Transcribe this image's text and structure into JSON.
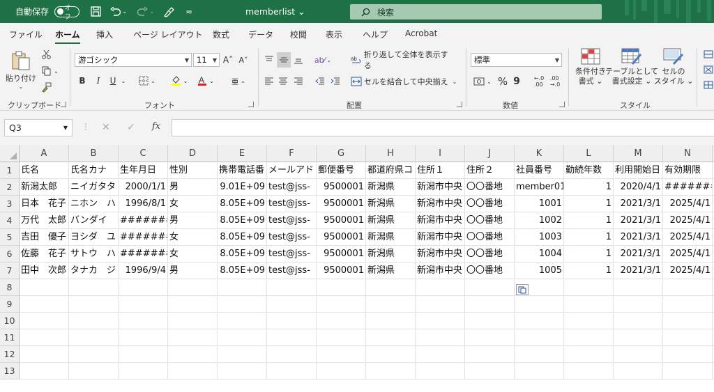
{
  "titlebar": {
    "autosave_label": "自動保存",
    "autosave_state": "オフ",
    "doc_title": "memberlist ⌄",
    "search_placeholder": "検索"
  },
  "menu": {
    "tabs": [
      "ファイル",
      "ホーム",
      "挿入",
      "ページ レイアウト",
      "数式",
      "データ",
      "校閲",
      "表示",
      "ヘルプ",
      "Acrobat"
    ],
    "active": "ホーム"
  },
  "ribbon": {
    "clipboard": {
      "paste_label": "貼り付け",
      "group_label": "クリップボード"
    },
    "font": {
      "font_name": "游ゴシック",
      "font_size": "11",
      "group_label": "フォント",
      "bold": "B",
      "italic": "I",
      "underline": "U"
    },
    "alignment": {
      "wrap_text": "折り返して全体を表示する",
      "merge_center": "セルを結合して中央揃え",
      "group_label": "配置"
    },
    "number": {
      "format": "標準",
      "percent": "%",
      "comma": "9",
      "group_label": "数値"
    },
    "styles": {
      "conditional": "条件付き\n書式 ⌄",
      "table": "テーブルとして\n書式設定 ⌄",
      "cell": "セルの\nスタイル ⌄",
      "group_label": "スタイル"
    }
  },
  "formula_bar": {
    "name_box": "Q3",
    "fx": "fx",
    "formula": ""
  },
  "grid": {
    "columns": [
      "A",
      "B",
      "C",
      "D",
      "E",
      "F",
      "G",
      "H",
      "I",
      "J",
      "K",
      "L",
      "M",
      "N"
    ],
    "rows": [
      "1",
      "2",
      "3",
      "4",
      "5",
      "6",
      "7",
      "8",
      "9",
      "10",
      "11",
      "12",
      "13"
    ],
    "data": [
      [
        "氏名",
        "氏名カナ",
        "生年月日",
        "性別",
        "携帯電話番",
        "メールアド",
        "郵便番号",
        "都道府県コ",
        "住所１",
        "住所２",
        "社員番号",
        "勤続年数",
        "利用開始日",
        "有効期限"
      ],
      [
        "新潟太郎",
        "ニイガタタ",
        "2000/1/1",
        "男",
        "9.01E+09",
        "test@jss-",
        "9500001",
        "新潟県",
        "新潟市中央",
        "〇〇番地",
        "member01",
        "1",
        "2020/4/1",
        "#######"
      ],
      [
        "日本　花子",
        "ニホン　ハ",
        "1996/8/1",
        "女",
        "8.05E+09",
        "test@jss-",
        "9500001",
        "新潟県",
        "新潟市中央",
        "〇〇番地",
        "1001",
        "1",
        "2021/3/1",
        "2025/4/1"
      ],
      [
        "万代　太郎",
        "バンダイ　",
        "#######",
        "男",
        "8.05E+09",
        "test@jss-",
        "9500001",
        "新潟県",
        "新潟市中央",
        "〇〇番地",
        "1002",
        "1",
        "2021/3/1",
        "2025/4/1"
      ],
      [
        "吉田　優子",
        "ヨシダ　ユ",
        "#######",
        "女",
        "8.05E+09",
        "test@jss-",
        "9500001",
        "新潟県",
        "新潟市中央",
        "〇〇番地",
        "1003",
        "1",
        "2021/3/1",
        "2025/4/1"
      ],
      [
        "佐藤　花子",
        "サトウ　ハ",
        "#######",
        "女",
        "8.05E+09",
        "test@jss-",
        "9500001",
        "新潟県",
        "新潟市中央",
        "〇〇番地",
        "1004",
        "1",
        "2021/3/1",
        "2025/4/1"
      ],
      [
        "田中　次郎",
        "タナカ　ジ",
        "1996/9/4",
        "男",
        "8.05E+09",
        "test@jss-",
        "9500001",
        "新潟県",
        "新潟市中央",
        "〇〇番地",
        "1005",
        "1",
        "2021/3/1",
        "2025/4/1"
      ]
    ],
    "numeric_columns": [
      "C",
      "E",
      "G",
      "K",
      "L",
      "M",
      "N"
    ]
  },
  "colors": {
    "brand": "#1e7145",
    "ribbon_bg": "#f3f3f3",
    "header_bg": "#efefef"
  }
}
